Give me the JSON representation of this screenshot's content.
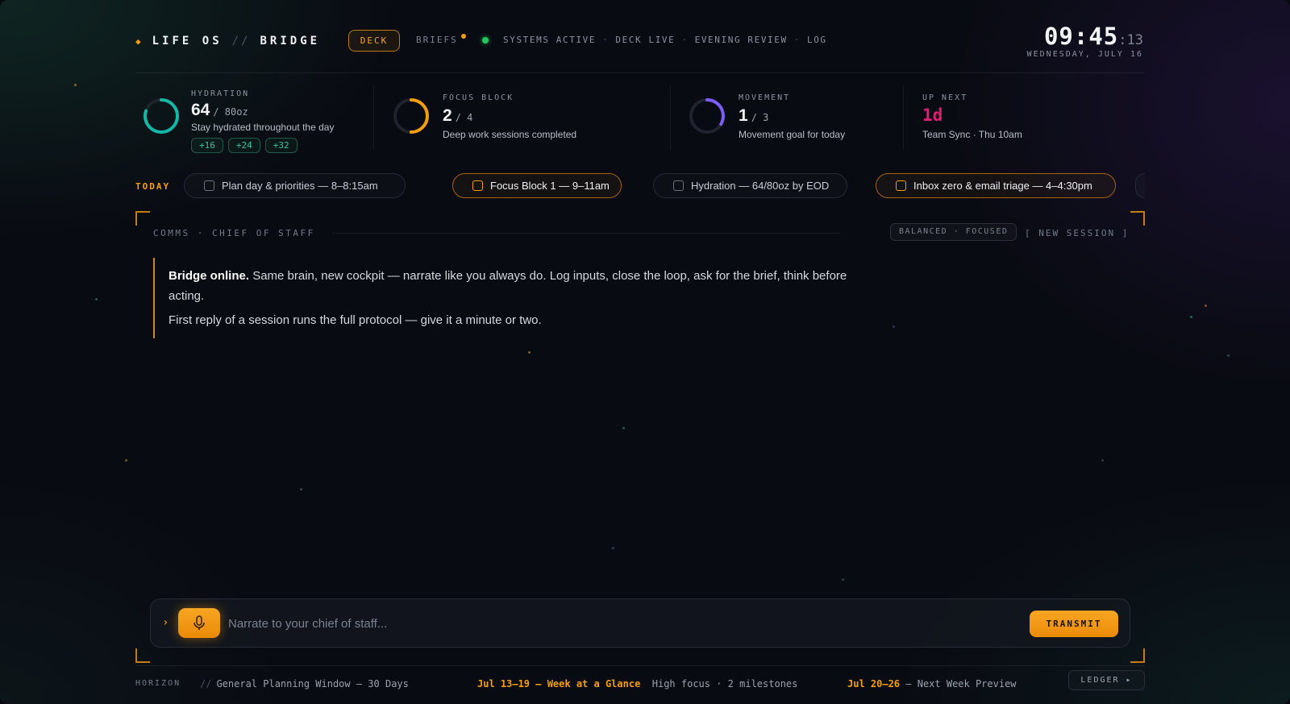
{
  "header": {
    "brand": "LIFE OS",
    "brand_sep": "//",
    "brand_sub": "BRIDGE",
    "nav": {
      "deck": "DECK",
      "briefs": "BRIEFS"
    },
    "status": {
      "systems": "SYSTEMS ACTIVE",
      "deck_live": "DECK LIVE",
      "evening_review": "EVENING REVIEW",
      "log": "LOG"
    },
    "clock": {
      "time": "09:45",
      "seconds": ":13",
      "date": "WEDNESDAY, JULY 16"
    }
  },
  "metrics": {
    "hydration": {
      "label": "HYDRATION",
      "value": "64",
      "of": "/ 80oz",
      "desc": "Stay hydrated throughout the day",
      "progress": 0.8,
      "color": "#14b8a6",
      "chips": [
        "+16",
        "+24",
        "+32"
      ]
    },
    "focus": {
      "label": "FOCUS BLOCK",
      "value": "2",
      "of": "/ 4",
      "desc": "Deep work sessions completed",
      "progress": 0.5,
      "color": "#f59e0b"
    },
    "movement": {
      "label": "MOVEMENT",
      "value": "1",
      "of": "/ 3",
      "desc": "Movement goal for today",
      "progress": 0.3333,
      "color": "#7c5cff"
    },
    "up_next": {
      "label": "UP NEXT",
      "value": "1d",
      "desc": "Team Sync · Thu 10am",
      "color": "#e11d74"
    }
  },
  "today": {
    "label": "TODAY",
    "tasks": [
      {
        "label": "Plan day & priorities — 8–8:15am",
        "highlighted": false
      },
      {
        "label": "Focus Block 1 — 9–11am",
        "highlighted": true
      },
      {
        "label": "Hydration — 64/80oz by EOD",
        "highlighted": false
      },
      {
        "label": "Inbox zero & email triage — 4–4:30pm",
        "highlighted": true
      }
    ]
  },
  "comms": {
    "label": "COMMS · CHIEF OF STAFF",
    "mode": "BALANCED · FOCUSED",
    "new_session": "[ NEW SESSION ]",
    "message": {
      "bold": "Bridge online.",
      "line1": "Same brain, new cockpit — narrate like you always do. Log inputs, close the loop, ask for the brief, think before acting.",
      "line2": "First reply of a session runs the full protocol — give it a minute or two."
    }
  },
  "input": {
    "caret": "›",
    "placeholder": "Narrate to your chief of staff...",
    "value": "",
    "transmit": "TRANSMIT"
  },
  "horizon": {
    "label": "HORIZON",
    "general_sep": "//",
    "general": "General Planning Window — 30 Days",
    "week_range": "Jul 13–19 — Week at a Glance",
    "week_note": "High focus · 2 milestones",
    "next_range": "Jul 20–26",
    "next_note": "— Next Week Preview",
    "ledger": "LEDGER ▸"
  },
  "colors": {
    "accent": "#f59e0b",
    "teal": "#14b8a6",
    "violet": "#7c5cff",
    "magenta": "#e11d74",
    "green": "#22c55e"
  },
  "icons": [
    "diamond-icon",
    "microphone-icon",
    "checkbox-icon",
    "caret-right-icon"
  ]
}
